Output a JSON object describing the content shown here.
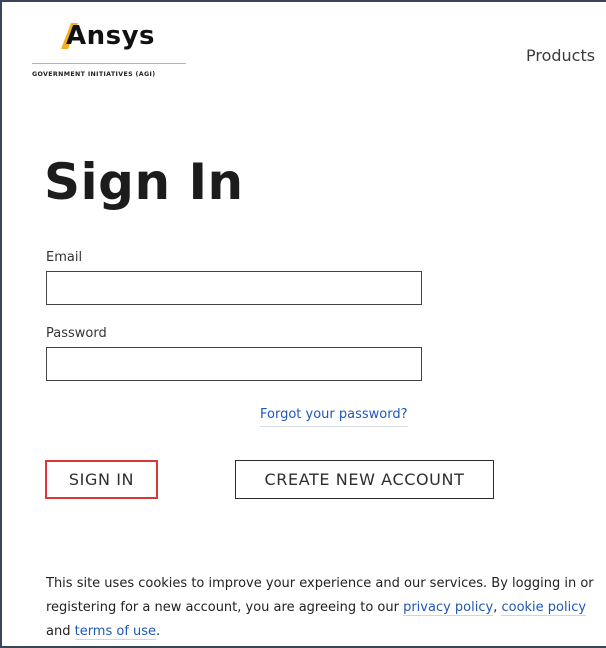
{
  "header": {
    "logo_word": "Ansys",
    "logo_subtitle": "GOVERNMENT INITIATIVES (AGI)",
    "nav_products": "Products"
  },
  "page": {
    "title": "Sign In"
  },
  "form": {
    "email_label": "Email",
    "email_value": "",
    "password_label": "Password",
    "password_value": "",
    "forgot_link": "Forgot your password?"
  },
  "buttons": {
    "sign_in": "SIGN IN",
    "create_account": "CREATE NEW ACCOUNT"
  },
  "cookie_notice": {
    "text_before": "This site uses cookies to improve your experience and our services. By logging in or registering for a new account, you are agreeing to our ",
    "privacy_link": "privacy policy",
    "text_comma": ", ",
    "cookie_link": "cookie policy",
    "text_and": " and ",
    "terms_link": "terms of use",
    "text_end": "."
  },
  "colors": {
    "brand_accent": "#f2b01e",
    "link": "#1f58b5",
    "highlight_border": "#d9373b"
  },
  "icons": {
    "logo_mark": "ansys-chevron-icon"
  }
}
